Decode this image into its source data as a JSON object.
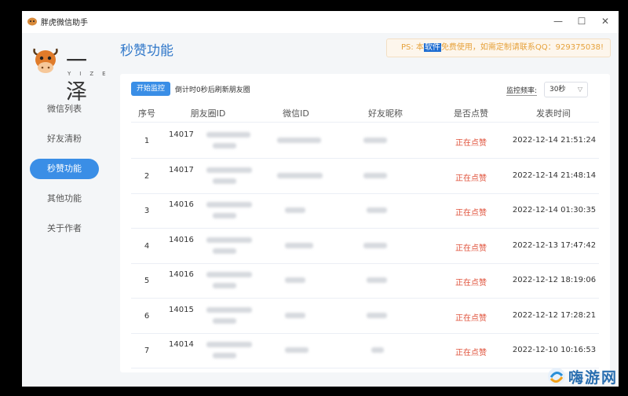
{
  "window": {
    "title": "胖虎微信助手",
    "controls": [
      "minimize-icon",
      "maximize-icon",
      "close-icon"
    ]
  },
  "brand": {
    "name": "一泽",
    "subtitle": "YIZE"
  },
  "nav": [
    {
      "label": "微信列表",
      "active": false
    },
    {
      "label": "好友清粉",
      "active": false
    },
    {
      "label": "秒赞功能",
      "active": true
    },
    {
      "label": "其他功能",
      "active": false
    },
    {
      "label": "关于作者",
      "active": false
    }
  ],
  "page": {
    "title": "秒赞功能",
    "notice_prefix": "PS: 本",
    "notice_highlight": "软件",
    "notice_suffix": "免费使用，如需定制请联系QQ：929375038!"
  },
  "toolbar": {
    "start_button": "开始监控",
    "countdown": "倒计时0秒后刷新朋友圈",
    "frequency_label": "监控频率:",
    "frequency_value": "30秒"
  },
  "table": {
    "headers": [
      "序号",
      "朋友圈ID",
      "微信ID",
      "好友昵称",
      "是否点赞",
      "发表时间"
    ],
    "rows": [
      {
        "no": "1",
        "id_prefix": "14017",
        "status": "正在点赞",
        "time": "2022-12-14 21:51:24"
      },
      {
        "no": "2",
        "id_prefix": "14017",
        "status": "正在点赞",
        "time": "2022-12-14 21:48:14"
      },
      {
        "no": "3",
        "id_prefix": "14016",
        "status": "正在点赞",
        "time": "2022-12-14 01:30:35"
      },
      {
        "no": "4",
        "id_prefix": "14016",
        "status": "正在点赞",
        "time": "2022-12-13 17:47:42"
      },
      {
        "no": "5",
        "id_prefix": "14016",
        "status": "正在点赞",
        "time": "2022-12-12 18:19:06"
      },
      {
        "no": "6",
        "id_prefix": "14015",
        "status": "正在点赞",
        "time": "2022-12-12 17:28:21"
      },
      {
        "no": "7",
        "id_prefix": "14014",
        "status": "正在点赞",
        "time": "2022-12-10 10:16:53"
      }
    ]
  },
  "watermark": {
    "text": "嗨游网"
  },
  "colors": {
    "accent": "#3a8ee6",
    "status": "#e0533c",
    "notice": "#e6a23c",
    "title": "#2f77c9"
  }
}
